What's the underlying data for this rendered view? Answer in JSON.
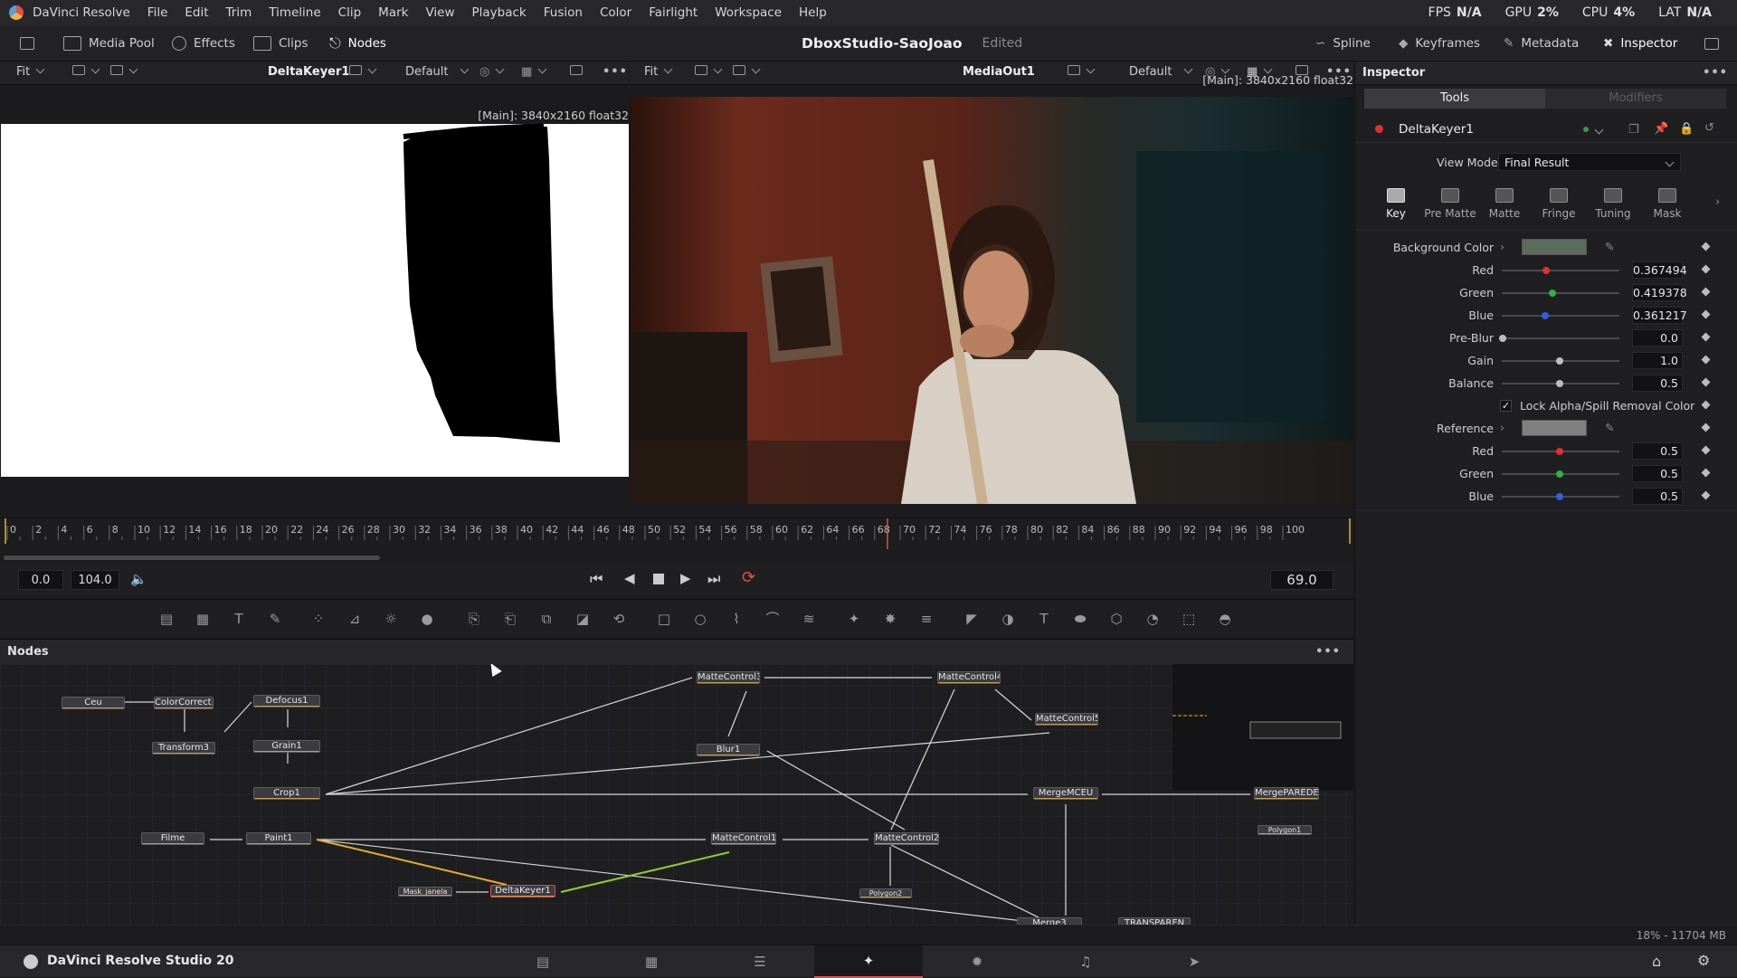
{
  "app": {
    "name": "DaVinci Resolve",
    "menu": [
      "File",
      "Edit",
      "Trim",
      "Timeline",
      "Clip",
      "Mark",
      "View",
      "Playback",
      "Fusion",
      "Color",
      "Fairlight",
      "Workspace",
      "Help"
    ],
    "stats": {
      "fps_label": "FPS",
      "fps": "N/A",
      "gpu_label": "GPU",
      "gpu": "2%",
      "cpu_label": "CPU",
      "cpu": "4%",
      "lat_label": "LAT",
      "lat": "N/A"
    }
  },
  "toolbar": {
    "media_pool": "Media Pool",
    "effects": "Effects",
    "clips": "Clips",
    "nodes": "Nodes",
    "project_title": "DboxStudio-SaoJoao",
    "edited": "Edited",
    "spline": "Spline",
    "keyframes": "Keyframes",
    "metadata": "Metadata",
    "inspector": "Inspector"
  },
  "viewer_left": {
    "fit": "Fit",
    "node": "DeltaKeyer1",
    "lut": "Default",
    "info": "[Main]: 3840x2160 float32"
  },
  "viewer_right": {
    "fit": "Fit",
    "node": "MediaOut1",
    "lut": "Default",
    "info": "[Main]: 3840x2160 float32"
  },
  "ruler": {
    "ticks": [
      "0",
      "2",
      "4",
      "6",
      "8",
      "10",
      "12",
      "14",
      "16",
      "18",
      "20",
      "22",
      "24",
      "26",
      "28",
      "30",
      "32",
      "34",
      "36",
      "38",
      "40",
      "42",
      "44",
      "46",
      "48",
      "50",
      "52",
      "54",
      "56",
      "58",
      "60",
      "62",
      "64",
      "66",
      "68",
      "70",
      "72",
      "74",
      "76",
      "78",
      "80",
      "82",
      "84",
      "86",
      "88",
      "90",
      "92",
      "94",
      "96",
      "98",
      "100"
    ],
    "playhead": 69
  },
  "transport": {
    "start": "0.0",
    "end": "104.0",
    "current": "69.0"
  },
  "nodes_panel": {
    "title": "Nodes",
    "nodes": [
      {
        "name": "Ceu"
      },
      {
        "name": "ColorCorrect..."
      },
      {
        "name": "Defocus1"
      },
      {
        "name": "Transform3"
      },
      {
        "name": "Grain1"
      },
      {
        "name": "Crop1"
      },
      {
        "name": "MatteControl3"
      },
      {
        "name": "MatteControl4"
      },
      {
        "name": "MatteControl5"
      },
      {
        "name": "Blur1"
      },
      {
        "name": "MergeMCEU"
      },
      {
        "name": "MergePAREDE"
      },
      {
        "name": "Polygon1"
      },
      {
        "name": "Filme"
      },
      {
        "name": "Paint1"
      },
      {
        "name": "MatteControl1"
      },
      {
        "name": "MatteControl2"
      },
      {
        "name": "Mask_janela"
      },
      {
        "name": "DeltaKeyer1"
      },
      {
        "name": "Polygon2"
      },
      {
        "name": "Merge3"
      },
      {
        "name": "TRANSPAREN"
      }
    ]
  },
  "inspector": {
    "title": "Inspector",
    "tab_tools": "Tools",
    "tab_modifiers": "Modifiers",
    "node_name": "DeltaKeyer1",
    "view_mode_label": "View Mode",
    "view_mode": "Final Result",
    "key_tabs": [
      "Key",
      "Pre Matte",
      "Matte",
      "Fringe",
      "Tuning",
      "Mask"
    ],
    "params": {
      "background_color": "Background Color",
      "bg_red_label": "Red",
      "bg_red": "0.367494",
      "bg_green_label": "Green",
      "bg_green": "0.419378",
      "bg_blue_label": "Blue",
      "bg_blue": "0.361217",
      "preblur_label": "Pre-Blur",
      "preblur": "0.0",
      "gain_label": "Gain",
      "gain": "1.0",
      "balance_label": "Balance",
      "balance": "0.5",
      "lock_label": "Lock Alpha/Spill Removal Color Bal.",
      "reference": "Reference",
      "ref_red_label": "Red",
      "ref_red": "0.5",
      "ref_green_label": "Green",
      "ref_green": "0.5",
      "ref_blue_label": "Blue",
      "ref_blue": "0.5"
    },
    "bg_swatch_color": "#5c6b5c",
    "ref_swatch_color": "#808080"
  },
  "status": {
    "memory": "18% - 11704 MB"
  },
  "pagebar": {
    "product": "DaVinci Resolve Studio 20"
  }
}
